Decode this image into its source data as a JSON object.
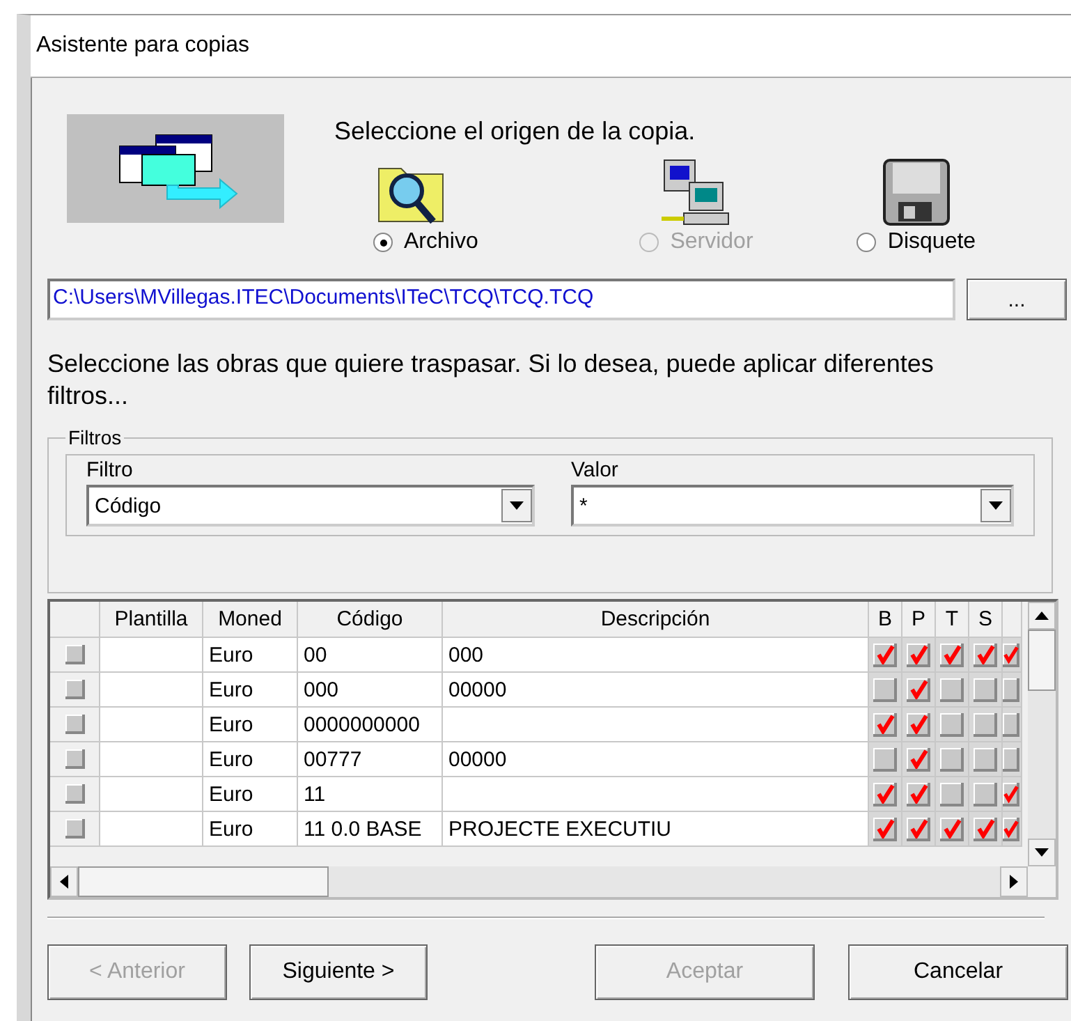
{
  "window": {
    "title": "Asistente para copias"
  },
  "source": {
    "prompt": "Seleccione el origen de la copia.",
    "options": [
      {
        "kind": "folder",
        "label": "Archivo",
        "selected": true,
        "disabled": false
      },
      {
        "kind": "server",
        "label": "Servidor",
        "selected": false,
        "disabled": true
      },
      {
        "kind": "floppy",
        "label": "Disquete",
        "selected": false,
        "disabled": false
      }
    ],
    "path": "C:\\Users\\MVillegas.ITEC\\Documents\\ITeC\\TCQ\\TCQ.TCQ",
    "browse_button": "..."
  },
  "instruction": "Seleccione las obras que quiere traspasar. Si lo desea, puede aplicar diferentes filtros...",
  "filters": {
    "legend": "Filtros",
    "filter_label": "Filtro",
    "filter_value": "Código",
    "value_label": "Valor",
    "value": "*"
  },
  "table": {
    "columns": [
      "Plantilla",
      "Moned",
      "Código",
      "Descripción",
      "B",
      "P",
      "T",
      "S"
    ],
    "rows": [
      {
        "selected": false,
        "plantilla": "",
        "moneda": "Euro",
        "codigo": "00",
        "descripcion": "000",
        "flags": [
          true,
          true,
          true,
          true,
          true
        ]
      },
      {
        "selected": false,
        "plantilla": "",
        "moneda": "Euro",
        "codigo": "000",
        "descripcion": "00000",
        "flags": [
          false,
          true,
          false,
          false,
          false
        ]
      },
      {
        "selected": false,
        "plantilla": "",
        "moneda": "Euro",
        "codigo": "0000000000",
        "descripcion": "",
        "flags": [
          true,
          true,
          false,
          false,
          false
        ]
      },
      {
        "selected": false,
        "plantilla": "",
        "moneda": "Euro",
        "codigo": "00777",
        "descripcion": "00000",
        "flags": [
          false,
          true,
          false,
          false,
          false
        ]
      },
      {
        "selected": false,
        "plantilla": "",
        "moneda": "Euro",
        "codigo": "11",
        "descripcion": "",
        "flags": [
          true,
          true,
          false,
          false,
          true
        ]
      },
      {
        "selected": false,
        "plantilla": "",
        "moneda": "Euro",
        "codigo": "11 0.0 BASE",
        "descripcion": "PROJECTE EXECUTIU",
        "flags": [
          true,
          true,
          true,
          true,
          true
        ]
      }
    ]
  },
  "buttons": [
    {
      "label": "< Anterior",
      "disabled": true
    },
    {
      "label": "Siguiente >",
      "disabled": false
    },
    {
      "label": "Aceptar",
      "disabled": true
    },
    {
      "label": "Cancelar",
      "disabled": false
    }
  ]
}
